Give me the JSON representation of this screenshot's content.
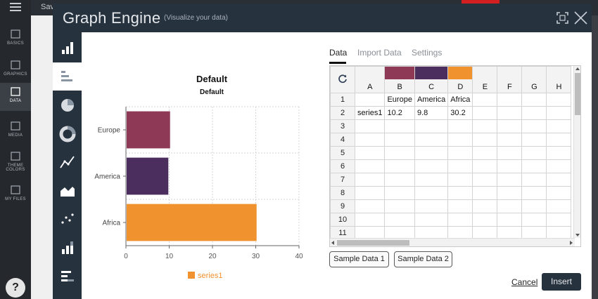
{
  "background_app": {
    "toolbar_text": "Sav",
    "rail_items": [
      {
        "label": "BASICS",
        "icon": "cube-icon"
      },
      {
        "label": "GRAPHICS",
        "icon": "image-icon"
      },
      {
        "label": "DATA",
        "icon": "bar-chart-icon",
        "active": true
      },
      {
        "label": "MEDIA",
        "icon": "video-icon"
      },
      {
        "label": "THEME COLORS",
        "icon": "palette-icon"
      },
      {
        "label": "MY FILES",
        "icon": "upload-icon"
      }
    ],
    "help_label": "?"
  },
  "modal": {
    "title": "Graph Engine",
    "subtitle": "(Visualize your data)",
    "chart_types": [
      "vertical-bar-icon",
      "horizontal-bar-icon",
      "pie-icon",
      "donut-icon",
      "line-icon",
      "area-icon",
      "scatter-icon",
      "stacked-bar-icon",
      "stacked-horizontal-bar-icon"
    ],
    "active_chart_type": 1,
    "tabs": [
      "Data",
      "Import Data",
      "Settings"
    ],
    "active_tab": 0,
    "sample_buttons": [
      "Sample Data 1",
      "Sample Data 2"
    ],
    "cancel_label": "Cancel",
    "insert_label": "Insert"
  },
  "sheet": {
    "columns": [
      "A",
      "B",
      "C",
      "D",
      "E",
      "F",
      "G",
      "H"
    ],
    "column_colors": {
      "B": "#8e3a56",
      "C": "#4b2d5e",
      "D": "#f0922e"
    },
    "rows": [
      {
        "n": "1",
        "cells": [
          "",
          "Europe",
          "America",
          "Africa",
          "",
          "",
          "",
          ""
        ]
      },
      {
        "n": "2",
        "cells": [
          "series1",
          "10.2",
          "9.8",
          "30.2",
          "",
          "",
          "",
          ""
        ]
      },
      {
        "n": "3",
        "cells": [
          "",
          "",
          "",
          "",
          "",
          "",
          "",
          ""
        ]
      },
      {
        "n": "4",
        "cells": [
          "",
          "",
          "",
          "",
          "",
          "",
          "",
          ""
        ]
      },
      {
        "n": "5",
        "cells": [
          "",
          "",
          "",
          "",
          "",
          "",
          "",
          ""
        ]
      },
      {
        "n": "6",
        "cells": [
          "",
          "",
          "",
          "",
          "",
          "",
          "",
          ""
        ]
      },
      {
        "n": "7",
        "cells": [
          "",
          "",
          "",
          "",
          "",
          "",
          "",
          ""
        ]
      },
      {
        "n": "8",
        "cells": [
          "",
          "",
          "",
          "",
          "",
          "",
          "",
          ""
        ]
      },
      {
        "n": "9",
        "cells": [
          "",
          "",
          "",
          "",
          "",
          "",
          "",
          ""
        ]
      },
      {
        "n": "10",
        "cells": [
          "",
          "",
          "",
          "",
          "",
          "",
          "",
          ""
        ]
      },
      {
        "n": "11",
        "cells": [
          "",
          "",
          "",
          "",
          "",
          "",
          "",
          ""
        ]
      }
    ]
  },
  "chart_data": {
    "type": "bar",
    "orientation": "horizontal",
    "title": "Default",
    "subtitle": "Default",
    "categories": [
      "Europe",
      "America",
      "Africa"
    ],
    "series": [
      {
        "name": "series1",
        "values": [
          10.2,
          9.8,
          30.2
        ]
      }
    ],
    "bar_colors": [
      "#8e3a56",
      "#4b2d5e",
      "#f0922e"
    ],
    "legend_color": "#f0922e",
    "xlim": [
      0,
      40
    ],
    "xticks": [
      0,
      10,
      20,
      30,
      40
    ],
    "grid": true,
    "legend_position": "bottom"
  }
}
